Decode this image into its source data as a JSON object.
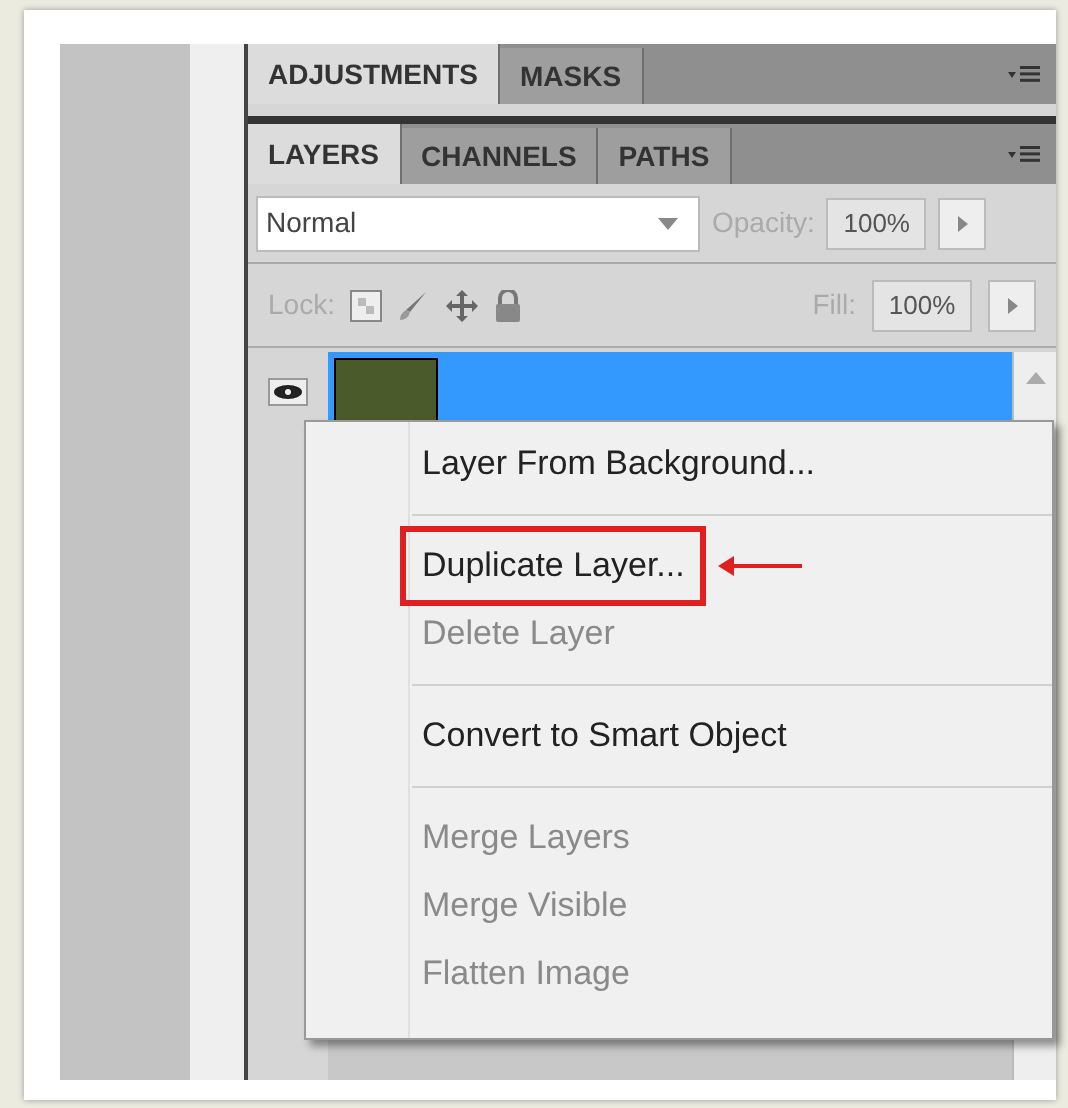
{
  "top_tabs": [
    {
      "label": "ADJUSTMENTS",
      "selected": true
    },
    {
      "label": "MASKS",
      "selected": false
    }
  ],
  "panel_tabs": [
    {
      "label": "LAYERS",
      "selected": true
    },
    {
      "label": "CHANNELS",
      "selected": false
    },
    {
      "label": "PATHS",
      "selected": false
    }
  ],
  "blend_mode": {
    "value": "Normal"
  },
  "opacity": {
    "label": "Opacity:",
    "value": "100%",
    "disabled": true
  },
  "lock": {
    "label": "Lock:",
    "disabled": true
  },
  "fill": {
    "label": "Fill:",
    "value": "100%",
    "disabled": true
  },
  "layers": [
    {
      "selected": true,
      "visible": true
    }
  ],
  "context_menu": {
    "items": [
      {
        "kind": "item",
        "label": "Layer From Background...",
        "disabled": false,
        "annotated": false
      },
      {
        "kind": "separator"
      },
      {
        "kind": "item",
        "label": "Duplicate Layer...",
        "disabled": false,
        "annotated": true
      },
      {
        "kind": "item",
        "label": "Delete Layer",
        "disabled": true,
        "annotated": false
      },
      {
        "kind": "separator"
      },
      {
        "kind": "item",
        "label": "Convert to Smart Object",
        "disabled": false,
        "annotated": false
      },
      {
        "kind": "separator"
      },
      {
        "kind": "item",
        "label": "Merge Layers",
        "disabled": true,
        "annotated": false
      },
      {
        "kind": "item",
        "label": "Merge Visible",
        "disabled": true,
        "annotated": false
      },
      {
        "kind": "item",
        "label": "Flatten Image",
        "disabled": true,
        "annotated": false
      }
    ]
  }
}
